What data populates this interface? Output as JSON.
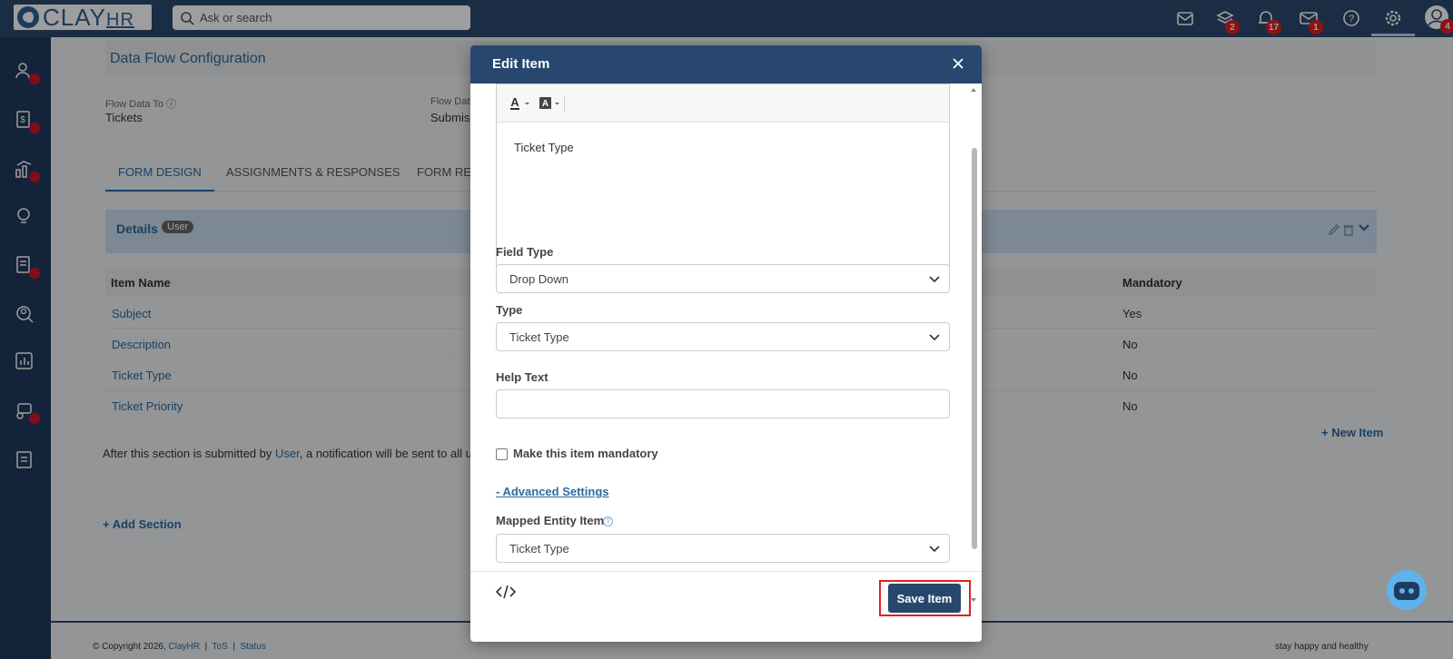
{
  "topbar": {
    "logo_text": "CLAY",
    "logo_suffix": "HR",
    "search_placeholder": "Ask or search",
    "icons": [
      {
        "name": "inbox-clock-icon",
        "badge": ""
      },
      {
        "name": "layers-icon",
        "badge": "2"
      },
      {
        "name": "bell-icon",
        "badge": "17"
      },
      {
        "name": "mail-icon",
        "badge": "1"
      },
      {
        "name": "help-icon",
        "badge": ""
      },
      {
        "name": "gear-icon",
        "badge": ""
      },
      {
        "name": "user-avatar-icon",
        "badge": "4"
      }
    ]
  },
  "sidebar": {
    "items": [
      {
        "name": "people-icon",
        "dot": true
      },
      {
        "name": "payroll-icon",
        "dot": true
      },
      {
        "name": "analytics-icon",
        "dot": true
      },
      {
        "name": "ideas-icon",
        "dot": false
      },
      {
        "name": "documents-icon",
        "dot": true
      },
      {
        "name": "recruit-icon",
        "dot": false
      },
      {
        "name": "reports-icon",
        "dot": false
      },
      {
        "name": "helpdesk-icon",
        "dot": true
      },
      {
        "name": "checklist-icon",
        "dot": false
      }
    ]
  },
  "page": {
    "title": "Data Flow Configuration",
    "flow_to_label": "Flow Data To",
    "flow_to_value": "Tickets",
    "flow_from_label": "Flow Dat",
    "flow_from_value": "Submiss",
    "tabs": [
      "FORM DESIGN",
      "ASSIGNMENTS & RESPONSES",
      "FORM RES"
    ],
    "section_title": "Details",
    "section_pill": "User",
    "table_headers": {
      "item_name": "Item Name",
      "mandatory": "Mandatory"
    },
    "rows": [
      {
        "name": "Subject",
        "mandatory": "Yes"
      },
      {
        "name": "Description",
        "mandatory": "No"
      },
      {
        "name": "Ticket Type",
        "mandatory": "No"
      },
      {
        "name": "Ticket Priority",
        "mandatory": "No"
      }
    ],
    "new_item": "+ New Item",
    "note_prefix": "After this section is submitted by ",
    "note_link": "User",
    "note_suffix": ", a notification will be sent to all u",
    "add_section": "+ Add Section"
  },
  "footer": {
    "copyright": "© Copyright 2026,",
    "brand": "ClayHR",
    "tos": "ToS",
    "status": "Status",
    "sep": "|",
    "tagline": "stay happy and healthy"
  },
  "modal": {
    "title": "Edit Item",
    "editor_text": "Ticket Type",
    "field_type_label": "Field Type",
    "field_type_value": "Drop Down",
    "type_label": "Type",
    "type_value": "Ticket Type",
    "help_text_label": "Help Text",
    "help_text_value": "",
    "mandatory_label": "Make this item mandatory",
    "mandatory_checked": false,
    "advanced_link": "- Advanced Settings",
    "mapped_label": "Mapped Entity Item",
    "mapped_value": "Ticket Type",
    "save_label": "Save Item"
  },
  "colors": {
    "topbar": "#2c4a6e",
    "sidebar": "#1f3b5e",
    "accent": "#2d6aa0",
    "badge": "#e02020",
    "highlight_outline": "#e12020"
  }
}
